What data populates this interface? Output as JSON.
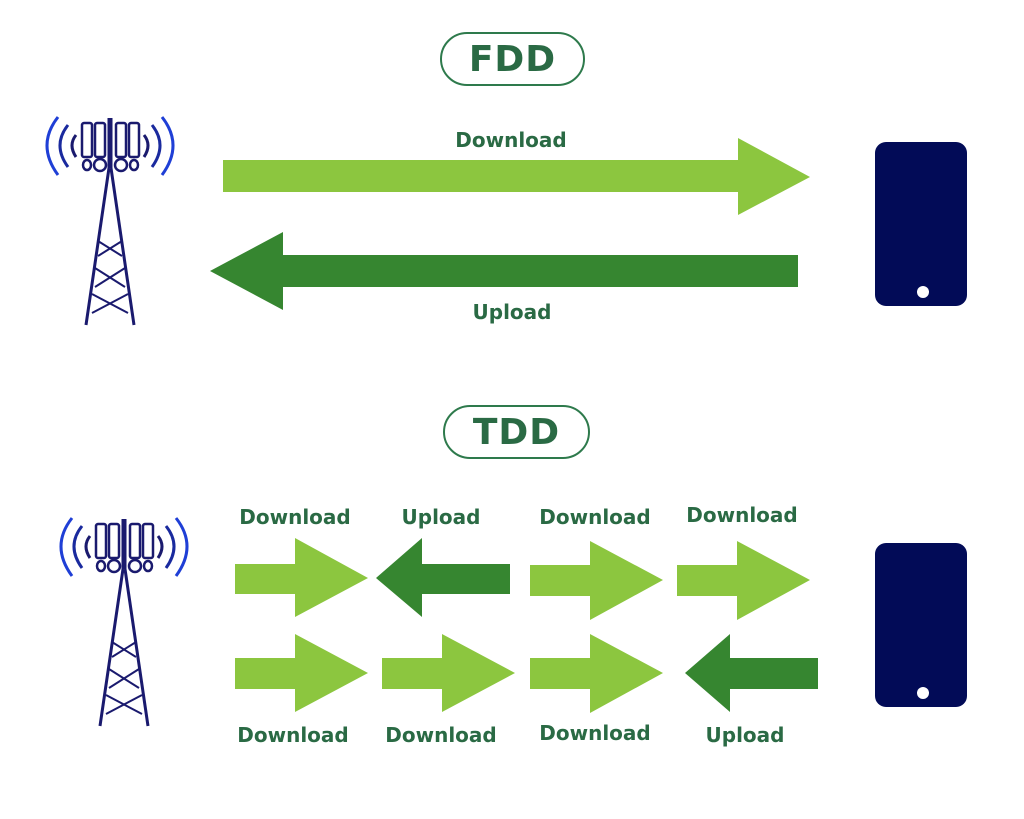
{
  "colors": {
    "download": "#8cc63f",
    "upload": "#368630",
    "label_text": "#2a6a44",
    "pill_border": "#2e7a4c",
    "device": "#020b57",
    "tower": "#1a1a6e",
    "signal_waves": "#1f3fd6"
  },
  "fdd": {
    "title": "FDD",
    "tower_icon": "cell-tower-icon",
    "device_icon": "smartphone-icon",
    "arrows": [
      {
        "label": "Download",
        "direction": "right",
        "type": "download"
      },
      {
        "label": "Upload",
        "direction": "left",
        "type": "upload"
      }
    ]
  },
  "tdd": {
    "title": "TDD",
    "tower_icon": "cell-tower-icon",
    "device_icon": "smartphone-icon",
    "rows": [
      [
        {
          "label": "Download",
          "direction": "right",
          "type": "download"
        },
        {
          "label": "Upload",
          "direction": "left",
          "type": "upload"
        },
        {
          "label": "Download",
          "direction": "right",
          "type": "download"
        },
        {
          "label": "Download",
          "direction": "right",
          "type": "download"
        }
      ],
      [
        {
          "label": "Download",
          "direction": "right",
          "type": "download"
        },
        {
          "label": "Download",
          "direction": "right",
          "type": "download"
        },
        {
          "label": "Download",
          "direction": "right",
          "type": "download"
        },
        {
          "label": "Upload",
          "direction": "left",
          "type": "upload"
        }
      ]
    ]
  }
}
